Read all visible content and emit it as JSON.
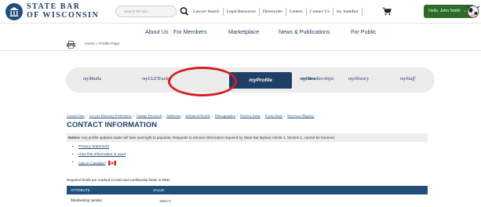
{
  "header": {
    "logo_line1": "STATE BAR",
    "logo_line2": "OF WISCONSIN",
    "search_placeholder": "Search the site...",
    "top_links": [
      "Lawyer Search",
      "Legal Resources",
      "Directories",
      "Careers",
      "Contact Us",
      "my StateBar"
    ],
    "user_label": "Hello, John Smith"
  },
  "main_nav": [
    "About Us",
    "For Members",
    "Marketplace",
    "News & Publications",
    "For Public"
  ],
  "breadcrumb": "Home » Profile Page",
  "sub_nav": {
    "tabs": [
      "myMedia",
      "myCLETracker",
      "myProfile",
      "myMemberships",
      "myDues",
      "myHistory",
      "myStaff"
    ],
    "active_index": 2
  },
  "profile_links": [
    "Contact Info",
    "Lawyer Directory Preferences",
    "Change Password",
    "Addresses",
    "Advanced Profile",
    "Demographics",
    "Practice Areas",
    "Focus Areas",
    "Successor Registry"
  ],
  "section_title": "CONTACT INFORMATION",
  "notice": {
    "label": "Notice:",
    "text": " Any profile updates made will take overnight to populate. Requests to remove information required by State Bar Bylaws Article 1, Section 1, cannot be honored."
  },
  "bullets": [
    "Privacy Statement",
    "How this information is used",
    "Live in Canada?"
  ],
  "required_text": "Required fields are marked in bold and confidential fields in RED.",
  "table": {
    "headers": [
      "ATTRIBUTE",
      "VALUE"
    ],
    "rows": [
      {
        "attribute": "Membership number",
        "value": "1000272"
      }
    ]
  },
  "colors": {
    "brand_navy": "#1f3f66",
    "link_blue": "#1f4f7a",
    "user_green": "#2e6b26",
    "highlight_red": "#d21f26"
  }
}
